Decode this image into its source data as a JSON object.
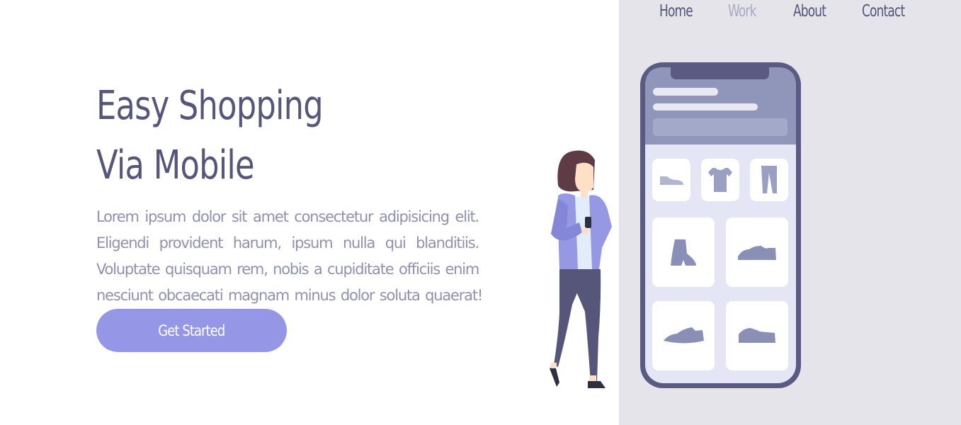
{
  "nav": {
    "items": [
      {
        "label": "Home",
        "muted": false
      },
      {
        "label": "Work",
        "muted": true
      },
      {
        "label": "About",
        "muted": false
      },
      {
        "label": "Contact",
        "muted": false
      }
    ]
  },
  "hero": {
    "title_line1": "Easy Shopping",
    "title_line2": "Via Mobile",
    "description_lines": [
      "Lorem ipsum dolor sit amet consectetur adipisicing elit.",
      "Eligendi provident harum, ipsum nulla qui blanditiis.",
      "Voluptate quisquam rem, nobis a cupiditate officiis enim",
      "nesciunt obcaecati magnam minus dolor soluta quaerat!"
    ],
    "cta_label": "Get Started"
  },
  "colors": {
    "text_dark": "#56567a",
    "text_muted": "#9190b0",
    "accent": "#9597e6",
    "panel": "#e5e4ea"
  },
  "illustration": {
    "icons": [
      "shoe-icon",
      "tshirt-icon",
      "pants-icon",
      "boot-icon",
      "sneaker-icon",
      "sneaker-icon",
      "sneaker-icon"
    ]
  }
}
